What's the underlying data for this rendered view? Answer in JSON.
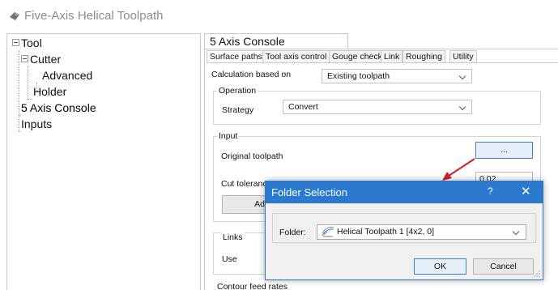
{
  "window": {
    "title": "Five-Axis Helical Toolpath"
  },
  "tree": {
    "items": [
      {
        "label": "Tool"
      },
      {
        "label": "Cutter"
      },
      {
        "label": "Advanced"
      },
      {
        "label": "Holder"
      },
      {
        "label": "5 Axis Console"
      },
      {
        "label": "Inputs"
      }
    ]
  },
  "console": {
    "title": "5 Axis Console",
    "tabs": [
      "Surface paths",
      "Tool axis control",
      "Gouge check",
      "Link",
      "Roughing",
      "Utility"
    ],
    "calc_label": "Calculation based on",
    "calc_value": "Existing toolpath",
    "operation": {
      "title": "Operation",
      "strategy_label": "Strategy",
      "strategy_value": "Convert"
    },
    "input": {
      "title": "Input",
      "original_label": "Original toolpath",
      "browse_label": "...",
      "cut_tolerance_label": "Cut toleranc",
      "cut_tolerance_value": "0.02",
      "ad_button": "Ad"
    },
    "links": {
      "title": "Links",
      "use_label": "Use"
    },
    "contour_label": "Contour feed rates"
  },
  "dialog": {
    "title": "Folder Selection",
    "help": "?",
    "close": "✕",
    "folder_label": "Folder:",
    "folder_value": "Helical Toolpath 1 [4x2, 0]",
    "ok": "OK",
    "cancel": "Cancel"
  },
  "colors": {
    "dialog_accent": "#2b78cf",
    "annotation_arrow": "#d42020"
  }
}
